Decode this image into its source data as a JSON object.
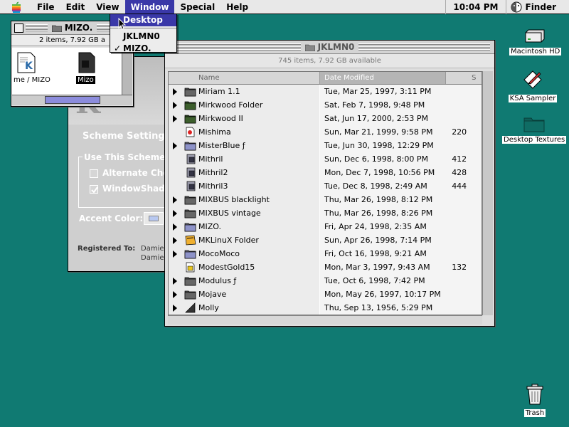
{
  "menubar": {
    "items": [
      "File",
      "Edit",
      "View",
      "Window",
      "Special",
      "Help"
    ],
    "active_item": "Window",
    "clock": "10:04 PM",
    "app_name": "Finder"
  },
  "window_menu": {
    "items": [
      "Desktop",
      "JKLMN0",
      "MIZO."
    ],
    "highlighted": "Desktop",
    "checked": "MIZO."
  },
  "mizo_window": {
    "title": "MIZO.",
    "info": "2 items, 7.92 GB a",
    "items": [
      "me / MIZO",
      "Mizo"
    ]
  },
  "scheme_window": {
    "heading": "Scheme Settings",
    "group_label": "Use This Scheme's",
    "checkbox_1": "Alternate Che",
    "checkbox_2": "WindowShad",
    "accent_label": "Accent Color:",
    "registered_label": "Registered To:",
    "registered_value_1": "Damie",
    "registered_value_2": "Damie"
  },
  "jk_window": {
    "title": "JKLMN0",
    "info": "745 items, 7.92 GB available",
    "columns": {
      "name": "Name",
      "date": "Date Modified",
      "size": "S"
    },
    "rows": [
      {
        "name": "Miriam 1.1",
        "date": "Tue, Mar 25, 1997, 3:11 PM",
        "size": "",
        "type": "folder",
        "expandable": true
      },
      {
        "name": "Mirkwood Folder",
        "date": "Sat, Feb 7, 1998, 9:48 PM",
        "size": "",
        "type": "folder-green",
        "expandable": true
      },
      {
        "name": "Mirkwood II",
        "date": "Sat, Jun 17, 2000, 2:53 PM",
        "size": "",
        "type": "folder-green",
        "expandable": true
      },
      {
        "name": "Mishima",
        "date": "Sun, Mar 21, 1999, 9:58 PM",
        "size": "220",
        "type": "doc-red",
        "expandable": false
      },
      {
        "name": "MisterBlue ƒ",
        "date": "Tue, Jun 30, 1998, 12:29 PM",
        "size": "",
        "type": "folder-blue",
        "expandable": true
      },
      {
        "name": "Mithril",
        "date": "Sun, Dec 6, 1998, 8:00 PM",
        "size": "412",
        "type": "app",
        "expandable": false
      },
      {
        "name": "Mithril2",
        "date": "Mon, Dec 7, 1998, 10:56 PM",
        "size": "428",
        "type": "app",
        "expandable": false
      },
      {
        "name": "Mithril3",
        "date": "Tue, Dec 8, 1998, 2:49 AM",
        "size": "444",
        "type": "app",
        "expandable": false
      },
      {
        "name": "MIXBUS blacklight",
        "date": "Thu, Mar 26, 1998, 8:12 PM",
        "size": "",
        "type": "folder",
        "expandable": true
      },
      {
        "name": "MIXBUS vintage",
        "date": "Thu, Mar 26, 1998, 8:26 PM",
        "size": "",
        "type": "folder",
        "expandable": true
      },
      {
        "name": "MIZO.",
        "date": "Fri, Apr 24, 1998, 2:35 AM",
        "size": "",
        "type": "folder-blue",
        "expandable": true
      },
      {
        "name": "MKLinuX Folder",
        "date": "Sun, Apr 26, 1998, 7:14 PM",
        "size": "",
        "type": "folder-yellow",
        "expandable": true
      },
      {
        "name": "MocoMoco",
        "date": "Fri, Oct 16, 1998, 9:21 AM",
        "size": "",
        "type": "folder-blue",
        "expandable": true
      },
      {
        "name": "ModestGold15",
        "date": "Mon, Mar 3, 1997, 9:43 AM",
        "size": "132",
        "type": "doc-yellow",
        "expandable": false
      },
      {
        "name": "Modulus ƒ",
        "date": "Tue, Oct 6, 1998, 7:42 PM",
        "size": "",
        "type": "folder",
        "expandable": true
      },
      {
        "name": "Mojave",
        "date": "Mon, May 26, 1997, 10:17 PM",
        "size": "",
        "type": "folder",
        "expandable": true
      },
      {
        "name": "Molly",
        "date": "Thu, Sep 13, 1956, 5:29 PM",
        "size": "",
        "type": "folder-triangle",
        "expandable": true
      }
    ]
  },
  "desktop": {
    "icons": [
      "Macintosh HD",
      "KSA Sampler",
      "Desktop Textures",
      "Trash"
    ]
  },
  "colors": {
    "desktop": "#107a72",
    "highlight": "#3a38a8"
  }
}
